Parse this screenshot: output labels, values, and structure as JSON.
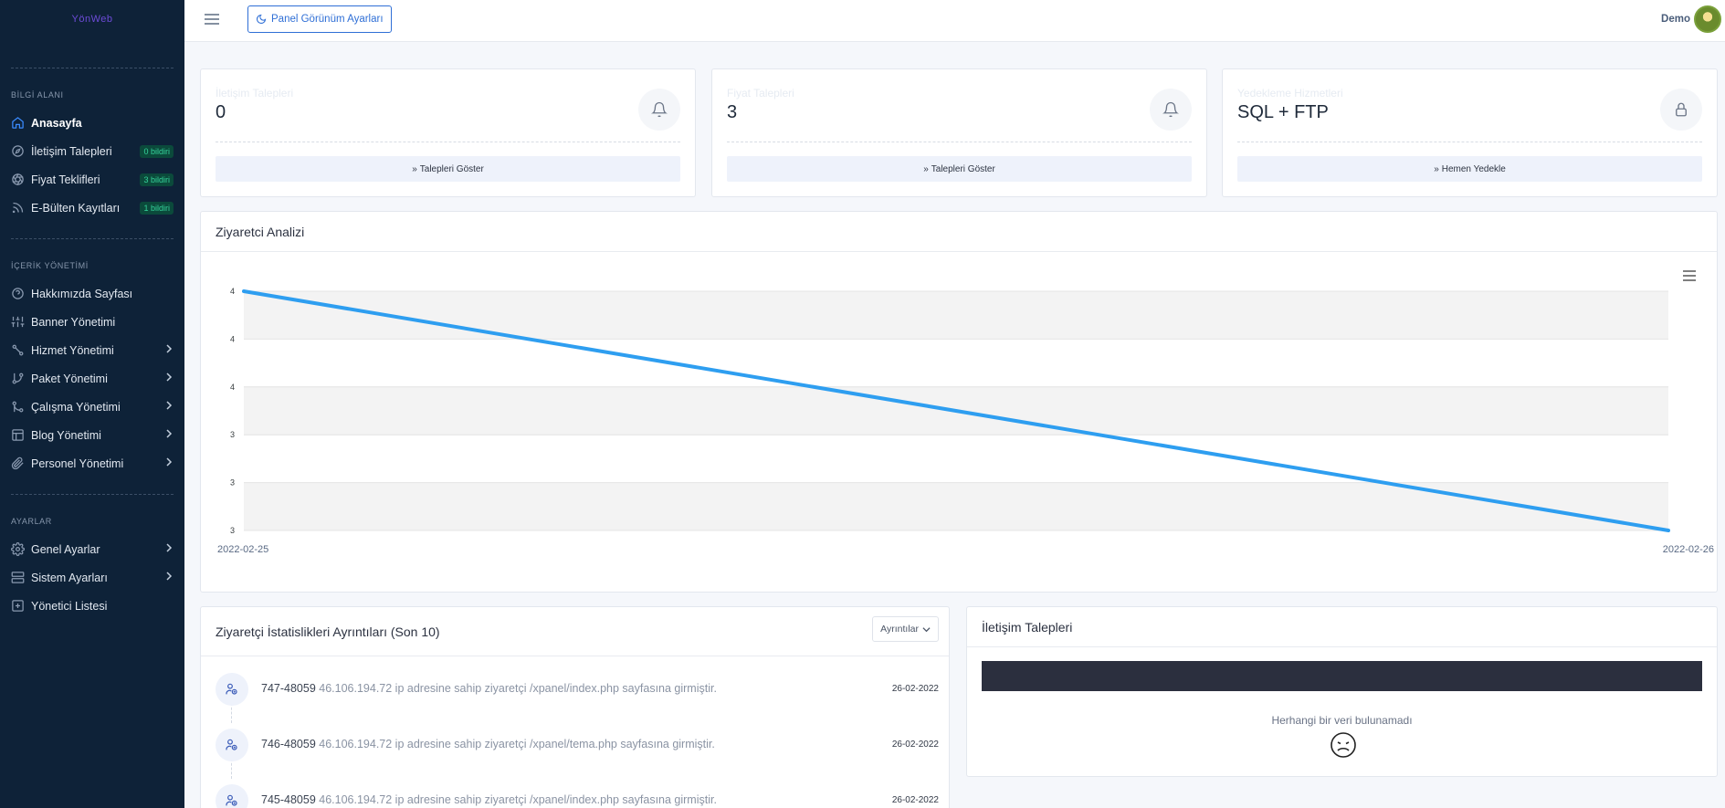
{
  "sidebar": {
    "logo": "YönWeb",
    "sections": [
      {
        "title": "BİLGİ ALANI"
      },
      {
        "title": "İÇERİK YÖNETİMİ"
      },
      {
        "title": "AYARLAR"
      }
    ],
    "items": {
      "anasayfa": {
        "label": "Anasayfa",
        "icon": "home-icon"
      },
      "iletisim": {
        "label": "İletişim Talepleri",
        "badge": "0 bildiri",
        "icon": "compass-icon"
      },
      "fiyat": {
        "label": "Fiyat Teklifleri",
        "badge": "3 bildiri",
        "icon": "aperture-icon"
      },
      "ebulten": {
        "label": "E-Bülten Kayıtları",
        "badge": "1 bildiri",
        "icon": "rss-icon"
      },
      "hakkimizda": {
        "label": "Hakkımızda Sayfası",
        "icon": "help-circle-icon"
      },
      "banner": {
        "label": "Banner Yönetimi",
        "icon": "sliders-icon"
      },
      "hizmet": {
        "label": "Hizmet Yönetimi",
        "icon": "share-nodes-icon"
      },
      "paket": {
        "label": "Paket Yönetimi",
        "icon": "git-branch-icon"
      },
      "calisma": {
        "label": "Çalışma Yönetimi",
        "icon": "git-merge-icon"
      },
      "blog": {
        "label": "Blog Yönetimi",
        "icon": "layout-icon"
      },
      "personel": {
        "label": "Personel Yönetimi",
        "icon": "paperclip-icon"
      },
      "genel": {
        "label": "Genel Ayarlar",
        "icon": "settings-icon"
      },
      "sistem": {
        "label": "Sistem Ayarları",
        "icon": "server-icon"
      },
      "yonetici": {
        "label": "Yönetici Listesi",
        "icon": "plus-square-icon"
      }
    }
  },
  "topbar": {
    "panel_button": "Panel Görünüm Ayarları",
    "user_name": "Demo"
  },
  "stats": [
    {
      "title": "İletişim Talepleri",
      "value": "0",
      "button": "Talepleri Göster",
      "icon": "bell-icon"
    },
    {
      "title": "Fiyat Talepleri",
      "value": "3",
      "button": "Talepleri Göster",
      "icon": "bell-icon"
    },
    {
      "title": "Yedekleme Hizmetleri",
      "value": "SQL + FTP",
      "button": "Hemen Yedekle",
      "icon": "lock-icon"
    }
  ],
  "chart_card": {
    "title": "Ziyaretci Analizi"
  },
  "chart_data": {
    "type": "line",
    "x": [
      "2022-02-25",
      "2022-02-26"
    ],
    "y_ticks": [
      "4",
      "4",
      "4",
      "3",
      "3",
      "3"
    ],
    "series": [
      {
        "values": [
          3.5,
          3.0
        ],
        "color": "#2e9ef0"
      }
    ],
    "ylim": [
      3.0,
      3.5
    ],
    "grid": true
  },
  "visitors": {
    "title": "Ziyaretçi İstatislikleri Ayrıntıları (Son 10)",
    "dropdown": "Ayrıntılar",
    "rows": [
      {
        "id": "747-48059",
        "text": "46.106.194.72 ip adresine sahip ziyaretçi /xpanel/index.php sayfasına girmiştir.",
        "date": "26-02-2022"
      },
      {
        "id": "746-48059",
        "text": "46.106.194.72 ip adresine sahip ziyaretçi /xpanel/tema.php sayfasına girmiştir.",
        "date": "26-02-2022"
      },
      {
        "id": "745-48059",
        "text": "46.106.194.72 ip adresine sahip ziyaretçi /xpanel/index.php sayfasına girmiştir.",
        "date": "26-02-2022"
      }
    ]
  },
  "contact_card": {
    "title": "İletişim Talepleri",
    "empty": "Herhangi bir veri bulunamadı"
  }
}
